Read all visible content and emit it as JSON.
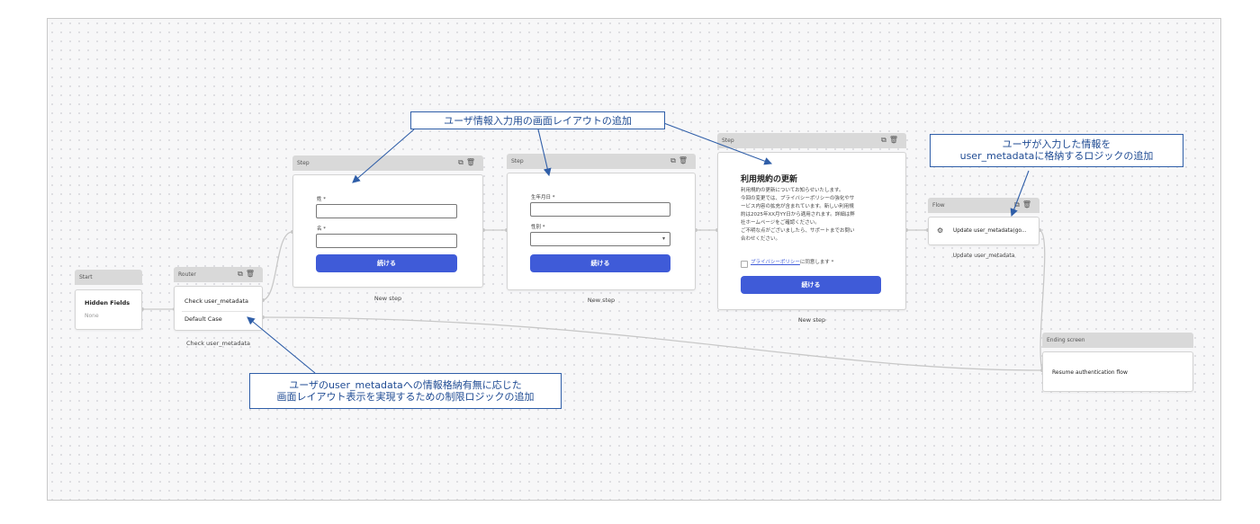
{
  "nodes": {
    "start": {
      "header": "Start",
      "field_title": "Hidden Fields",
      "field_value": "None"
    },
    "router": {
      "header": "Router",
      "case1": "Check user_metadata",
      "case2": "Default Case",
      "caption": "Check user_metadata"
    },
    "step1": {
      "header": "Step",
      "label1": "姓 *",
      "label2": "名 *",
      "button": "続ける",
      "caption": "New step"
    },
    "step2": {
      "header": "Step",
      "label1": "生年月日 *",
      "label2": "性別 *",
      "button": "続ける",
      "caption": "New step"
    },
    "step3": {
      "header": "Step",
      "title": "利用規約の更新",
      "body": [
        "利用規約の更新についてお知らせいたします。",
        "今回の変更では、プライバシーポリシーの強化やサ",
        "ービス内容の拡充が含まれています。新しい利用規",
        "約は2025年XX月YY日から適用されます。詳細は弊",
        "社ホームページをご確認ください。",
        "ご不明な点がございましたら、サポートまでお問い",
        "合わせください。"
      ],
      "link": "プライバシーポリシー",
      "consent": "に同意します *",
      "button": "続ける",
      "caption": "New step"
    },
    "flow": {
      "header": "Flow",
      "action": "Update user_metadata(go...",
      "caption": "Update user_metadata"
    },
    "ending": {
      "header": "Ending screen",
      "text": "Resume authentication flow"
    }
  },
  "annotations": {
    "top": "ユーザ情報入力用の画面レイアウトの追加",
    "right_line1": "ユーザが入力した情報を",
    "right_line2": "user_metadataに格納するロジックの追加",
    "bottom_line1": "ユーザのuser_metadataへの情報格納有無に応じた",
    "bottom_line2": "画面レイアウト表示を実現するための制限ロジックの追加"
  },
  "icons": {
    "copy": "copy-icon",
    "delete": "trash-icon",
    "flow_action": "update-icon",
    "dropdown": "chevron-down-icon"
  },
  "colors": {
    "button": "#3f5bd8",
    "annotation": "#2f5ea8",
    "header": "#d9d9d9"
  }
}
